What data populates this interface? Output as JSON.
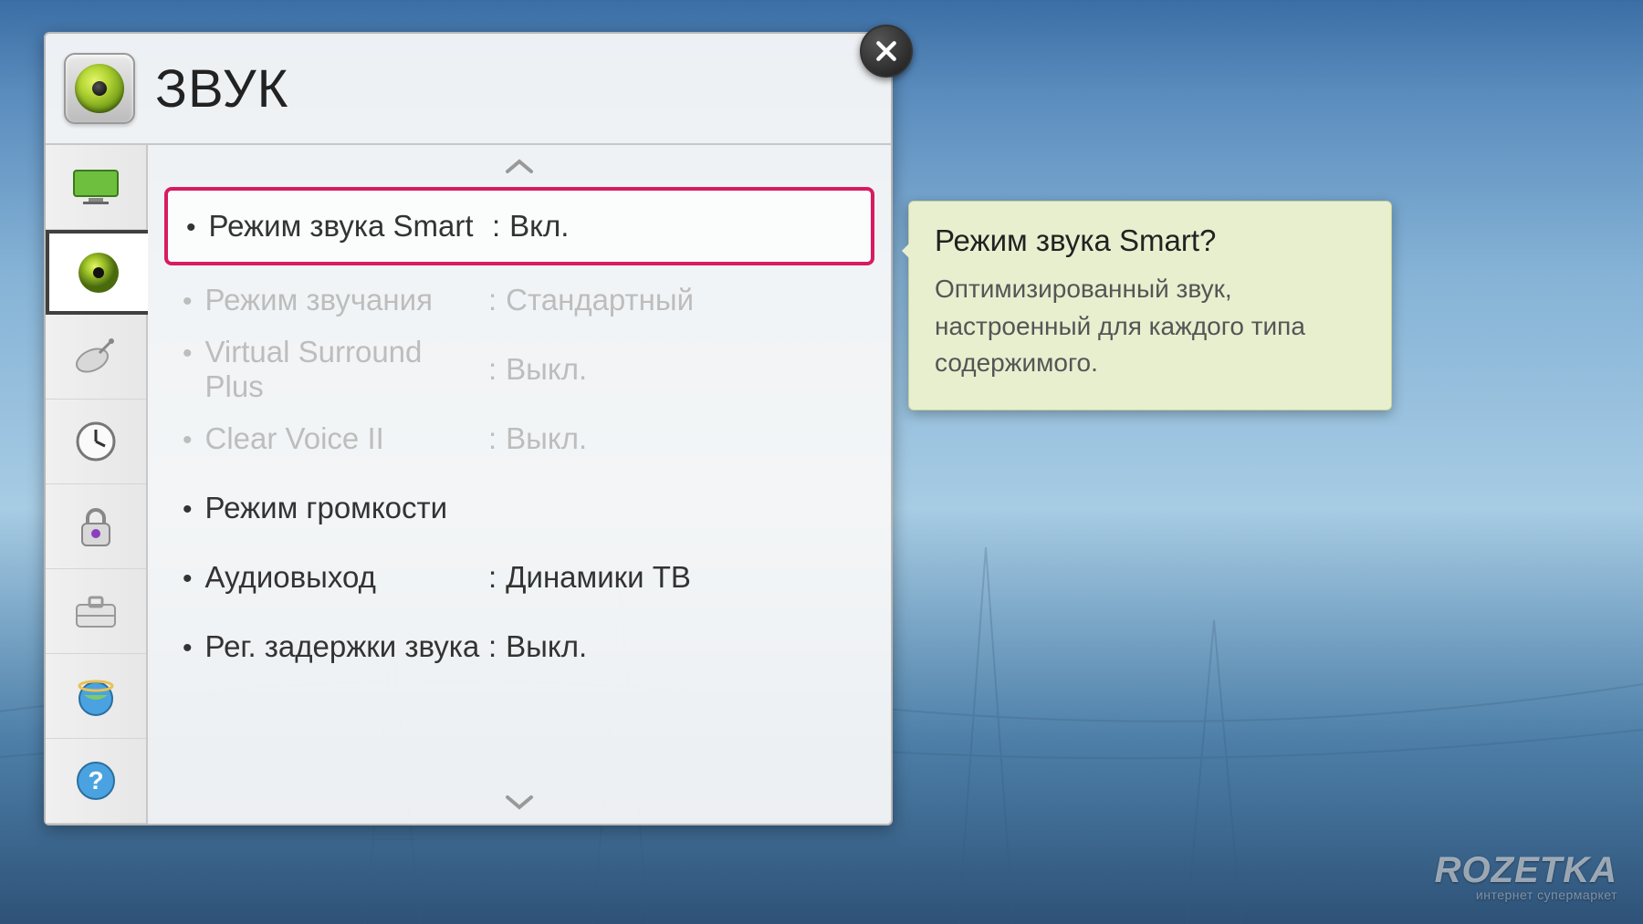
{
  "header": {
    "title": "ЗВУК"
  },
  "sidebar": {
    "items": [
      {
        "id": "picture",
        "selected": false
      },
      {
        "id": "sound",
        "selected": true
      },
      {
        "id": "channel",
        "selected": false
      },
      {
        "id": "time",
        "selected": false
      },
      {
        "id": "lock",
        "selected": false
      },
      {
        "id": "setup",
        "selected": false
      },
      {
        "id": "network",
        "selected": false
      },
      {
        "id": "support",
        "selected": false
      }
    ]
  },
  "settings": [
    {
      "label": "Режим звука Smart",
      "value": "Вкл.",
      "selected": true,
      "disabled": false,
      "has_value": true
    },
    {
      "label": "Режим звучания",
      "value": "Стандартный",
      "selected": false,
      "disabled": true,
      "has_value": true
    },
    {
      "label": "Virtual Surround Plus",
      "value": "Выкл.",
      "selected": false,
      "disabled": true,
      "has_value": true
    },
    {
      "label": "Clear Voice II",
      "value": "Выкл.",
      "selected": false,
      "disabled": true,
      "has_value": true
    },
    {
      "label": "Режим громкости",
      "value": "",
      "selected": false,
      "disabled": false,
      "has_value": false
    },
    {
      "label": "Аудиовыход",
      "value": "Динамики ТВ",
      "selected": false,
      "disabled": false,
      "has_value": true
    },
    {
      "label": "Рег. задержки звука",
      "value": "Выкл.",
      "selected": false,
      "disabled": false,
      "has_value": true
    }
  ],
  "tooltip": {
    "title": "Режим звука Smart?",
    "body": "Оптимизированный звук, настроенный для каждого типа содержимого."
  },
  "watermark": {
    "brand": "ROZETKA",
    "tag": "интернет супермаркет"
  }
}
